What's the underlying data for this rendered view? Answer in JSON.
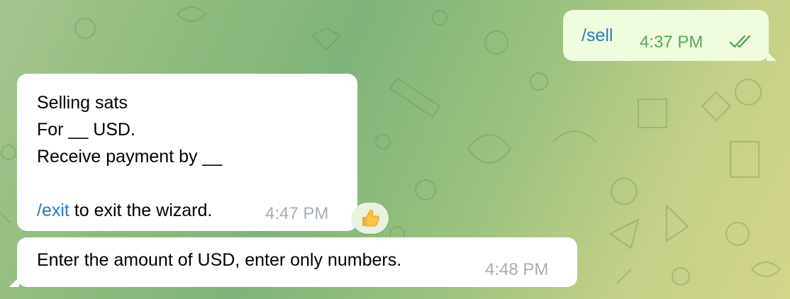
{
  "outgoing": {
    "command": "/sell",
    "time": "4:37 PM",
    "status_icon": "double-check-icon"
  },
  "incoming_1": {
    "lines": [
      "Selling sats",
      "For __ USD.",
      "Receive payment by __"
    ],
    "exit_command": "/exit",
    "exit_text": " to exit the wizard.",
    "time": "4:47 PM",
    "reaction": {
      "icon": "thumbs-up-icon"
    }
  },
  "incoming_2": {
    "text": "Enter the amount of USD, enter only numbers.",
    "time": "4:48 PM"
  },
  "colors": {
    "outgoing_bubble": "#effdde",
    "incoming_bubble": "#ffffff",
    "link": "#2b7bc0",
    "outgoing_meta": "#5ba55b",
    "incoming_meta": "#a5adb4"
  }
}
